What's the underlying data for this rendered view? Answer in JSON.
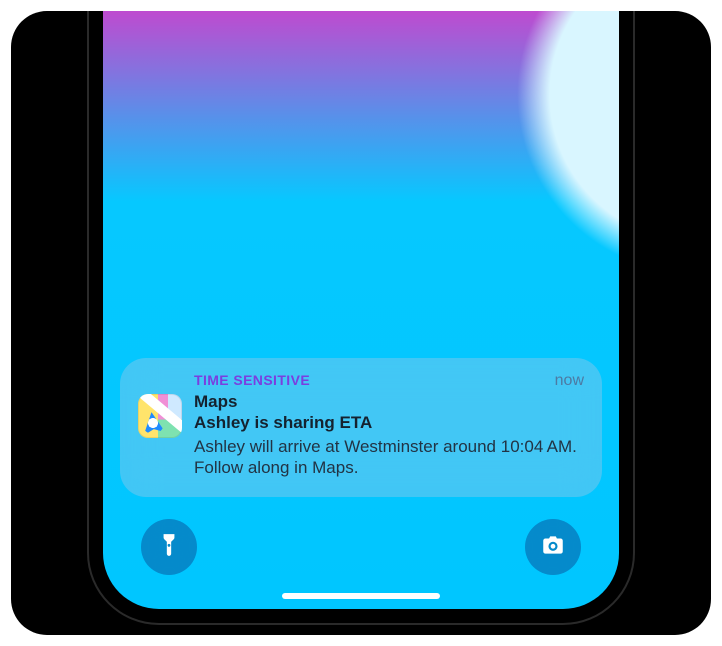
{
  "notification": {
    "badge": "TIME SENSITIVE",
    "timestamp": "now",
    "app_name": "Maps",
    "title": "Ashley is sharing ETA",
    "message": "Ashley will arrive at Westminster around 10:04 AM. Follow along in Maps.",
    "icon": "maps-app-icon"
  },
  "lockscreen": {
    "flashlight_label": "Flashlight",
    "camera_label": "Camera"
  }
}
